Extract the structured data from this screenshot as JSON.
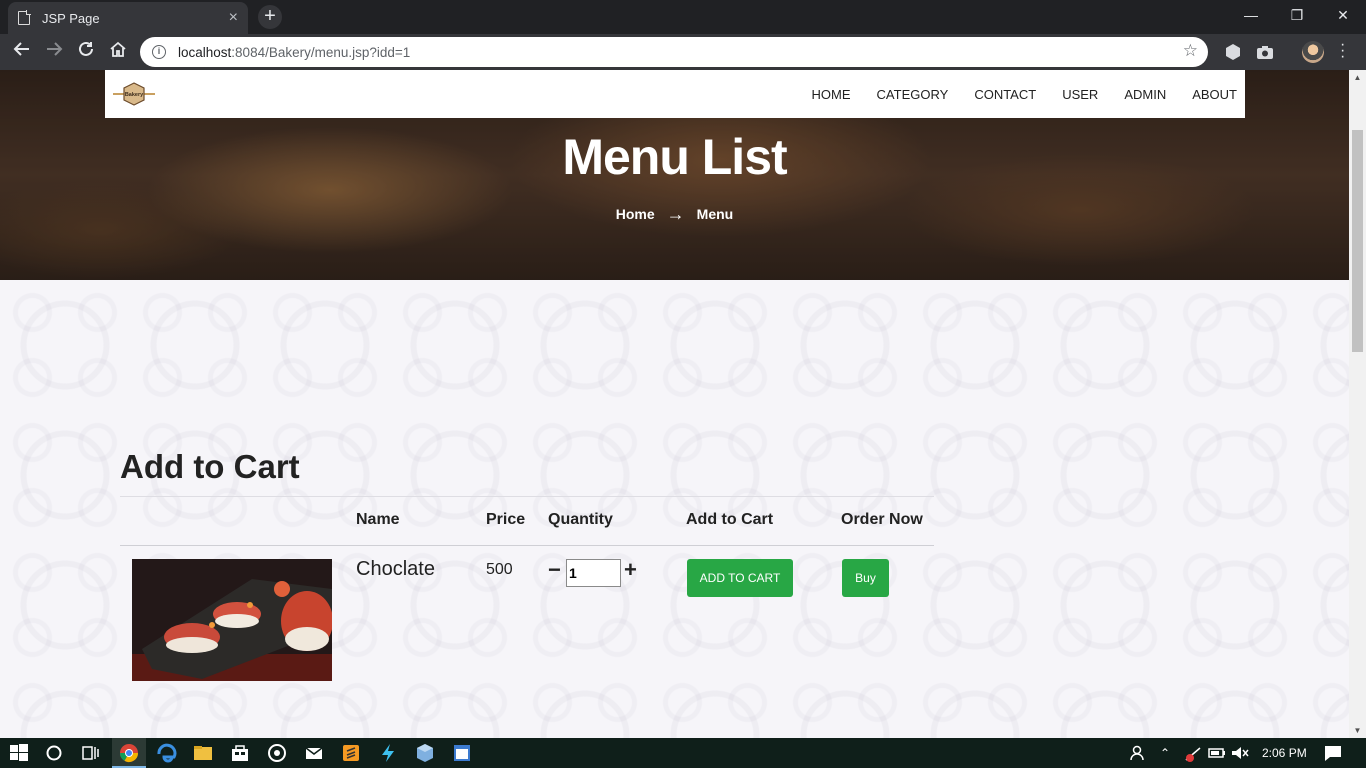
{
  "browser": {
    "tab_title": "JSP Page",
    "tab_close": "×",
    "new_tab": "+",
    "window_controls": {
      "minimize": "—",
      "restore": "❐",
      "close": "✕"
    },
    "url_host": "localhost",
    "url_path": ":8084/Bakery/menu.jsp?idd=1",
    "star": "☆"
  },
  "site": {
    "logo_text": "Bakery",
    "nav": [
      "HOME",
      "CATEGORY",
      "CONTACT",
      "USER",
      "ADMIN",
      "ABOUT"
    ],
    "hero_title": "Menu List",
    "breadcrumb": {
      "home": "Home",
      "arrow": "→",
      "current": "Menu"
    }
  },
  "cart": {
    "title": "Add to Cart",
    "headers": {
      "name": "Name",
      "price": "Price",
      "quantity": "Quantity",
      "add_to_cart": "Add to Cart",
      "order_now": "Order Now"
    },
    "item": {
      "name": "Choclate",
      "price": "500",
      "minus": "−",
      "plus": "+",
      "quantity": "1",
      "add_button": "ADD TO CART",
      "buy_button": "Buy"
    }
  },
  "taskbar": {
    "time": "2:06 PM"
  },
  "colors": {
    "accent_green": "#28a745",
    "chrome_dark": "#202124",
    "taskbar": "#0f1f1a"
  }
}
